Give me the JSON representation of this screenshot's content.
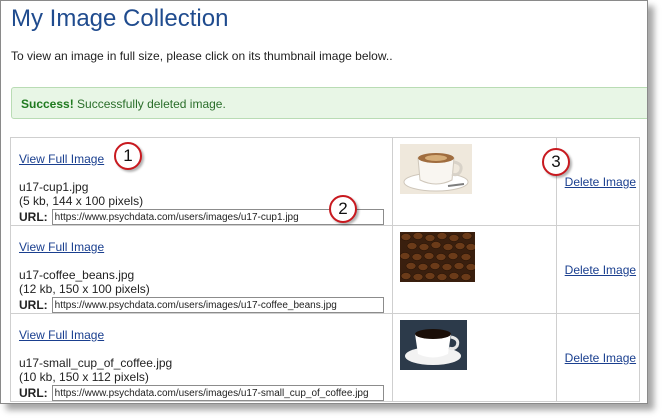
{
  "page": {
    "title": "My Image Collection",
    "intro": "To view an image in full size, please click on its thumbnail image below.."
  },
  "alert": {
    "label": "Success!",
    "message": "Successfully deleted image."
  },
  "url_label": "URL:",
  "rows": [
    {
      "view_label": "View Full Image",
      "filename": "u17-cup1.jpg",
      "details": "(5 kb, 144 x 100 pixels)",
      "url": "https://www.psychdata.com/users/images/u17-cup1.jpg",
      "delete_label": "Delete Image",
      "thumbnail": "cup-of-coffee-on-saucer"
    },
    {
      "view_label": "View Full Image",
      "filename": "u17-coffee_beans.jpg",
      "details": "(12 kb, 150 x 100 pixels)",
      "url": "https://www.psychdata.com/users/images/u17-coffee_beans.jpg",
      "delete_label": "Delete Image",
      "thumbnail": "coffee-beans"
    },
    {
      "view_label": "View Full Image",
      "filename": "u17-small_cup_of_coffee.jpg",
      "details": "(10 kb, 150 x 112 pixels)",
      "url": "https://www.psychdata.com/users/images/u17-small_cup_of_coffee.jpg",
      "delete_label": "Delete Image",
      "thumbnail": "black-coffee-cup"
    }
  ],
  "callouts": [
    "1",
    "2",
    "3"
  ],
  "colors": {
    "title": "#1f4b8e",
    "link": "#1a3f8f",
    "alert_bg": "#e8f6e6",
    "alert_text": "#1f7a1f",
    "callout_border": "#c8191f"
  }
}
